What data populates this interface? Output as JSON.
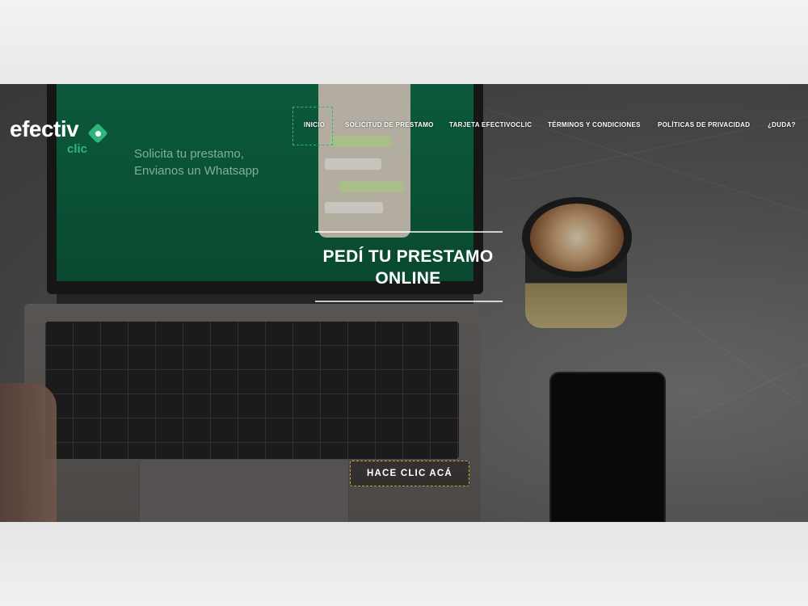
{
  "logo": {
    "main": "efectiv",
    "sub": "clic"
  },
  "laptop_screen": {
    "line1": "Solicita tu prestamo,",
    "line2": "Envianos un Whatsapp"
  },
  "nav": {
    "items": [
      {
        "label": "INICIO",
        "active": true
      },
      {
        "label": "SOLICITUD DE PRESTAMO"
      },
      {
        "label": "TARJETA EFECTIVOCLIC"
      },
      {
        "label": "TÉRMINOS Y CONDICIONES"
      },
      {
        "label": "POLÍTICAS DE PRIVACIDAD"
      },
      {
        "label": "¿DUDA?"
      }
    ]
  },
  "hero": {
    "title_line1": "PEDÍ TU PRESTAMO",
    "title_line2": "ONLINE",
    "cta_label": "HACE CLIC ACÁ"
  },
  "colors": {
    "brand_green": "#2fb67d",
    "cta_border": "#c9a23a"
  }
}
